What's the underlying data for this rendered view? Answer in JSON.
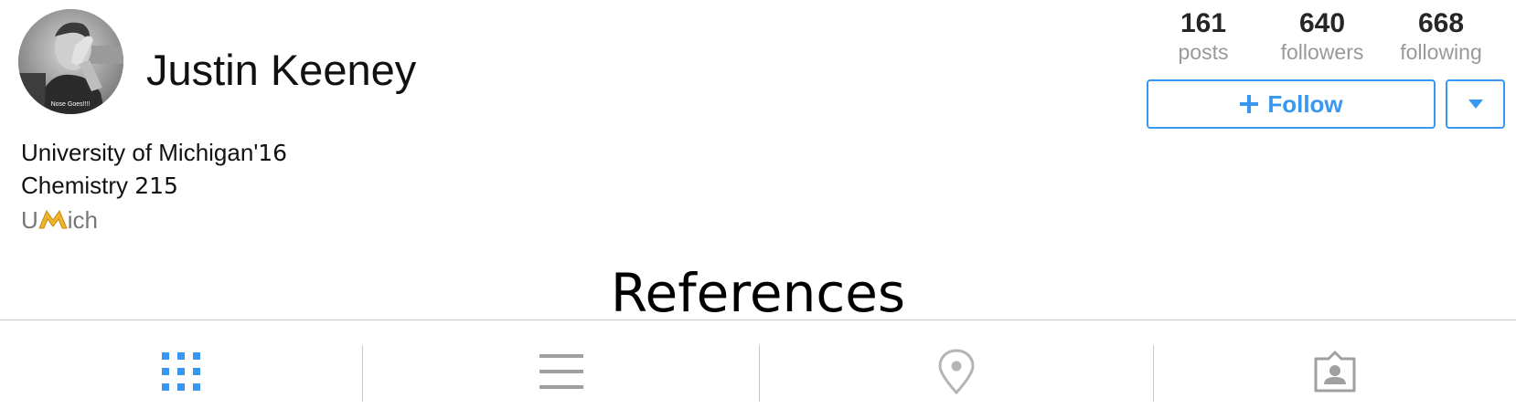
{
  "profile": {
    "username": "Justin Keeney",
    "avatar_caption": "Nose Goes!!!!",
    "bio": {
      "line1_text": "University of Michigan'",
      "line1_year": "16",
      "line2_text": "Chemistry ",
      "line2_number": "215",
      "line3_prefix": "U",
      "line3_suffix": "ich"
    }
  },
  "stats": {
    "posts": {
      "value": "161",
      "label": "posts"
    },
    "followers": {
      "value": "640",
      "label": "followers"
    },
    "following": {
      "value": "668",
      "label": "following"
    }
  },
  "actions": {
    "follow_label": "Follow",
    "follow_icon": "plus-icon",
    "dropdown_icon": "caret-down-icon"
  },
  "overlay": {
    "title": "References"
  },
  "tabs": [
    {
      "name": "grid-view",
      "icon": "grid-icon",
      "active": true
    },
    {
      "name": "list-view",
      "icon": "list-icon",
      "active": false
    },
    {
      "name": "map-view",
      "icon": "location-pin-icon",
      "active": false
    },
    {
      "name": "tagged-view",
      "icon": "tagged-person-icon",
      "active": false
    }
  ],
  "colors": {
    "accent": "#3897f0",
    "inactive_icon": "#a0a0a0",
    "muted_text": "#999999",
    "divider": "#c8c8c8",
    "m_logo": "#f0b42c"
  }
}
